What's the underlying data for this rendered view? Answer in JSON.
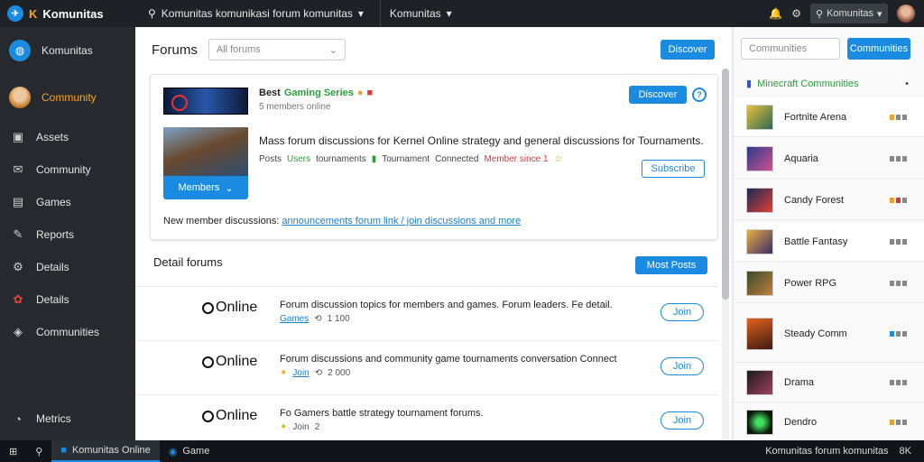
{
  "topbar": {
    "brand": "Komunitas",
    "brand_initial": "K",
    "title": "Komunitas komunikasi forum komunitas",
    "dropdown": "Komunitas"
  },
  "sidebar": {
    "items": [
      {
        "label": "Komunitas",
        "icon": "globe-icon"
      },
      {
        "label": "Community",
        "icon": "avatar-icon"
      },
      {
        "label": "Assets",
        "icon": "inbox-icon"
      },
      {
        "label": "Community",
        "icon": "mail-icon"
      },
      {
        "label": "Games",
        "icon": "folder-icon"
      },
      {
        "label": "Reports",
        "icon": "tools-icon"
      },
      {
        "label": "Details",
        "icon": "chart-icon"
      },
      {
        "label": "Details",
        "icon": "badge-icon"
      },
      {
        "label": "Communities",
        "icon": "layers-icon"
      }
    ],
    "bottom_item": "Metrics"
  },
  "main": {
    "title": "Forums",
    "filter_placeholder": "All forums",
    "new_button": "Discover",
    "featured": {
      "title_prefix": "Best",
      "title_accent": "Gaming Series",
      "subtitle": "5 members online",
      "follow_button": "Discover",
      "body": "Mass forum discussions for Kernel Online strategy and general discussions for Tournaments.",
      "meta_a": "Posts",
      "meta_b": "Users",
      "meta_c": "tournaments",
      "meta_d": "Tournament",
      "meta_e": "Connected",
      "meta_f": "Member since 1",
      "dropdown_button": "Members",
      "subscribe_button": "Subscribe",
      "footer_text": "New member discussions:",
      "footer_link": "announcements forum link / join discussions and more"
    },
    "section_title": "Detail forums",
    "section_button": "Most Posts",
    "rows": [
      {
        "status": "Online",
        "text": "Forum discussion topics for members and games. Forum leaders. Fe detail.",
        "meta_link": "Games",
        "meta_count": "1 100"
      },
      {
        "status": "Online",
        "text": "Forum discussions and community game tournaments conversation Connect",
        "meta_link": "Join",
        "meta_count": "2 000"
      },
      {
        "status": "Online",
        "text": "Fo Gamers battle strategy tournament forums.",
        "meta_link": "Join",
        "meta_count": "2"
      }
    ],
    "row_button": "Join"
  },
  "right": {
    "search_placeholder": "Communities",
    "search_button": "Communities",
    "header": "Minecraft Communities",
    "items": [
      {
        "label": "Fortnite Arena",
        "colors": [
          "#f0a030",
          "#888888",
          "#888888"
        ]
      },
      {
        "label": "Aquaria",
        "colors": [
          "#888888",
          "#888888",
          "#888888"
        ]
      },
      {
        "label": "Candy Forest",
        "colors": [
          "#f0a030",
          "#d9383a",
          "#888888"
        ]
      },
      {
        "label": "Battle Fantasy",
        "colors": [
          "#888888",
          "#888888",
          "#888888"
        ]
      },
      {
        "label": "Power RPG",
        "colors": [
          "#888888",
          "#888888",
          "#888888"
        ]
      },
      {
        "label": "Steady Comm",
        "colors": [
          "#1a8be0",
          "#888888",
          "#888888"
        ]
      },
      {
        "label": "Drama",
        "colors": [
          "#888888",
          "#888888",
          "#888888"
        ]
      },
      {
        "label": "Dendro",
        "colors": [
          "#f0a030",
          "#888888",
          "#888888"
        ]
      }
    ]
  },
  "taskbar": {
    "app1": "Komunitas Online",
    "app2": "Game",
    "status": "Komunitas forum komunitas",
    "clock": "8K"
  },
  "colors": {
    "accent": "#1a8be0",
    "brand": "#f5a623",
    "green": "#2e9e3e",
    "red": "#d9383a"
  }
}
